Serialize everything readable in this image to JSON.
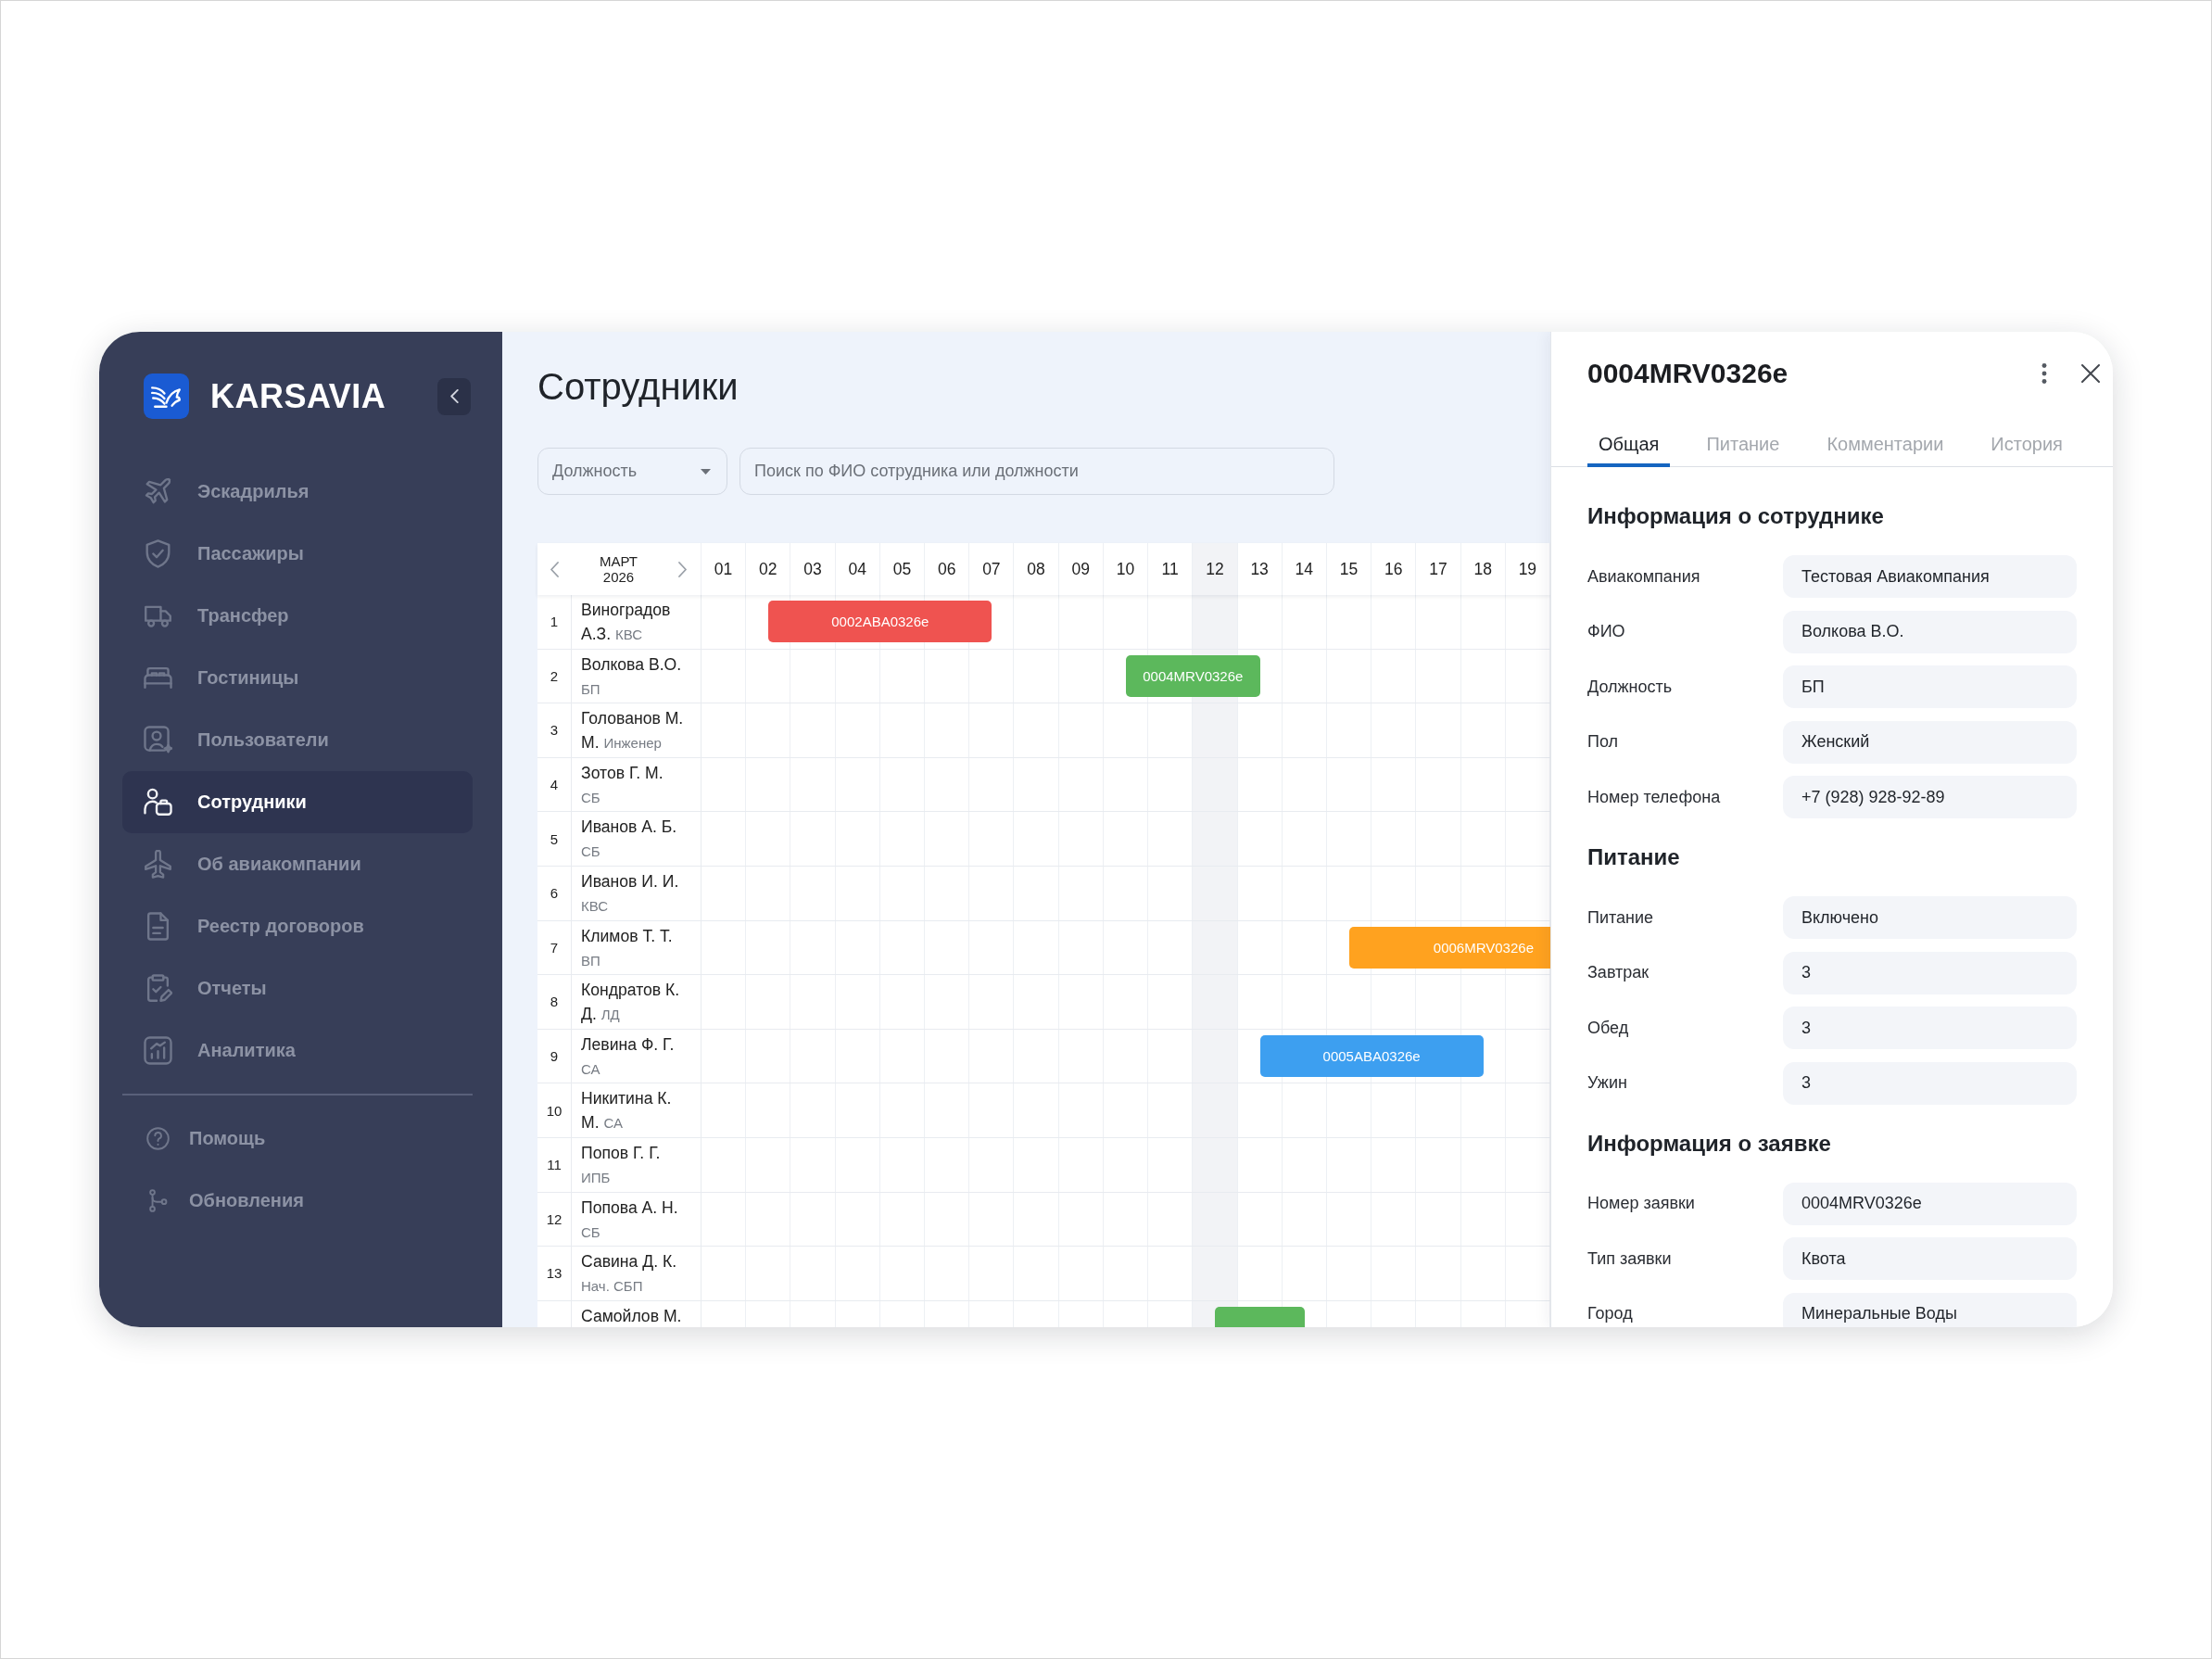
{
  "sidebar": {
    "logo": "KARSAVIA",
    "items": [
      {
        "label": "Эскадрилья",
        "selected": false
      },
      {
        "label": "Пассажиры",
        "selected": false
      },
      {
        "label": "Трансфер",
        "selected": false
      },
      {
        "label": "Гостиницы",
        "selected": false
      },
      {
        "label": "Пользователи",
        "selected": false
      },
      {
        "label": "Сотрудники",
        "selected": true
      },
      {
        "label": "Об авиакомпании",
        "selected": false
      },
      {
        "label": "Реестр договоров",
        "selected": false
      },
      {
        "label": "Отчеты",
        "selected": false
      },
      {
        "label": "Аналитика",
        "selected": false
      }
    ],
    "footer_items": [
      {
        "label": "Помощь",
        "selected": false
      },
      {
        "label": "Обновления",
        "selected": false
      }
    ]
  },
  "page_title": "Сотрудники",
  "filters": {
    "position": {
      "placeholder": "Должность"
    },
    "search": {
      "placeholder": "Поиск по ФИО сотрудника или должности"
    }
  },
  "schedule": {
    "month": "МАРТ",
    "year": "2026",
    "days": [
      {
        "label": "01",
        "today": false
      },
      {
        "label": "02",
        "today": false
      },
      {
        "label": "03",
        "today": false
      },
      {
        "label": "04",
        "today": false
      },
      {
        "label": "05",
        "today": false
      },
      {
        "label": "06",
        "today": false
      },
      {
        "label": "07",
        "today": false
      },
      {
        "label": "08",
        "today": false
      },
      {
        "label": "09",
        "today": false
      },
      {
        "label": "10",
        "today": false
      },
      {
        "label": "11",
        "today": false
      },
      {
        "label": "12",
        "today": true
      },
      {
        "label": "13",
        "today": false
      },
      {
        "label": "14",
        "today": false
      },
      {
        "label": "15",
        "today": false
      },
      {
        "label": "16",
        "today": false
      },
      {
        "label": "17",
        "today": false
      },
      {
        "label": "18",
        "today": false
      },
      {
        "label": "19",
        "today": false
      }
    ],
    "rows": [
      {
        "number": "1",
        "name": "Виноградов А.З.",
        "role": "КВС",
        "booking": {
          "label": "0002ABA0326e",
          "color": "#ef5350",
          "days": [
            false,
            true,
            true,
            true,
            true,
            true,
            true,
            false,
            false,
            false,
            false,
            false,
            false,
            false,
            false,
            false,
            false,
            false,
            false
          ]
        }
      },
      {
        "number": "2",
        "name": "Волкова В.О.",
        "role": "БП",
        "booking": {
          "label": "0004MRV0326e",
          "color": "#5cb85c",
          "days": [
            false,
            false,
            false,
            false,
            false,
            false,
            false,
            false,
            false,
            true,
            true,
            true,
            true,
            false,
            false,
            false,
            false,
            false,
            false
          ]
        }
      },
      {
        "number": "3",
        "name": "Голованов М. М.",
        "role": "Инженер"
      },
      {
        "number": "4",
        "name": "Зотов Г. М.",
        "role": "СБ"
      },
      {
        "number": "5",
        "name": "Иванов А. Б.",
        "role": "СБ"
      },
      {
        "number": "6",
        "name": "Иванов И. И.",
        "role": "КВС"
      },
      {
        "number": "7",
        "name": "Климов Т. Т.",
        "role": "ВП",
        "booking": {
          "label": "0006MRV0326e",
          "color": "#ffa21f",
          "days": [
            false,
            false,
            false,
            false,
            false,
            false,
            false,
            false,
            false,
            false,
            false,
            false,
            false,
            false,
            true,
            true,
            true,
            true,
            true
          ],
          "continues": true
        }
      },
      {
        "number": "8",
        "name": "Кондратов К. Д.",
        "role": "ЛД"
      },
      {
        "number": "9",
        "name": "Левина Ф. Г.",
        "role": "СА",
        "booking": {
          "label": "0005ABA0326e",
          "color": "#3d9ff0",
          "days": [
            false,
            false,
            false,
            false,
            false,
            false,
            false,
            false,
            false,
            false,
            false,
            false,
            true,
            true,
            true,
            true,
            true,
            true,
            false
          ]
        }
      },
      {
        "number": "10",
        "name": "Никитина К. М.",
        "role": "СА"
      },
      {
        "number": "11",
        "name": "Попов Г. Г.",
        "role": "ИПБ"
      },
      {
        "number": "12",
        "name": "Попова А. Н.",
        "role": "СБ"
      },
      {
        "number": "13",
        "name": "Савина Д. К.",
        "role": "Нач. СБП"
      },
      {
        "name": "Самойлов М.",
        "booking": {
          "color": "#5cb85c",
          "days": [
            false,
            false,
            false,
            false,
            false,
            false,
            false,
            false,
            false,
            false,
            false,
            true,
            true,
            true,
            false,
            false,
            false,
            false,
            false
          ]
        }
      }
    ]
  },
  "details": {
    "title": "0004MRV0326e",
    "tabs": [
      {
        "label": "Общая",
        "selected": true
      },
      {
        "label": "Питание",
        "selected": false
      },
      {
        "label": "Комментарии",
        "selected": false
      },
      {
        "label": "История",
        "selected": false
      }
    ],
    "sections": [
      {
        "heading": "Информация о сотруднике",
        "fields": [
          {
            "label": "Авиакомпания",
            "value": "Тестовая Авиакомпания"
          },
          {
            "label": "ФИО",
            "value": "Волкова В.О."
          },
          {
            "label": "Должность",
            "value": "БП"
          },
          {
            "label": "Пол",
            "value": "Женский"
          },
          {
            "label": "Номер телефона",
            "value": "+7 (928) 928-92-89"
          }
        ]
      },
      {
        "heading": "Питание",
        "fields": [
          {
            "label": "Питание",
            "value": "Включено"
          },
          {
            "label": "Завтрак",
            "value": "3"
          },
          {
            "label": "Обед",
            "value": "3"
          },
          {
            "label": "Ужин",
            "value": "3"
          }
        ]
      },
      {
        "heading": "Информация о заявке",
        "fields": [
          {
            "label": "Номер заявки",
            "value": "0004MRV0326e"
          },
          {
            "label": "Тип заявки",
            "value": "Квота"
          },
          {
            "label": "Город",
            "value": "Минеральные Воды"
          }
        ]
      }
    ]
  }
}
